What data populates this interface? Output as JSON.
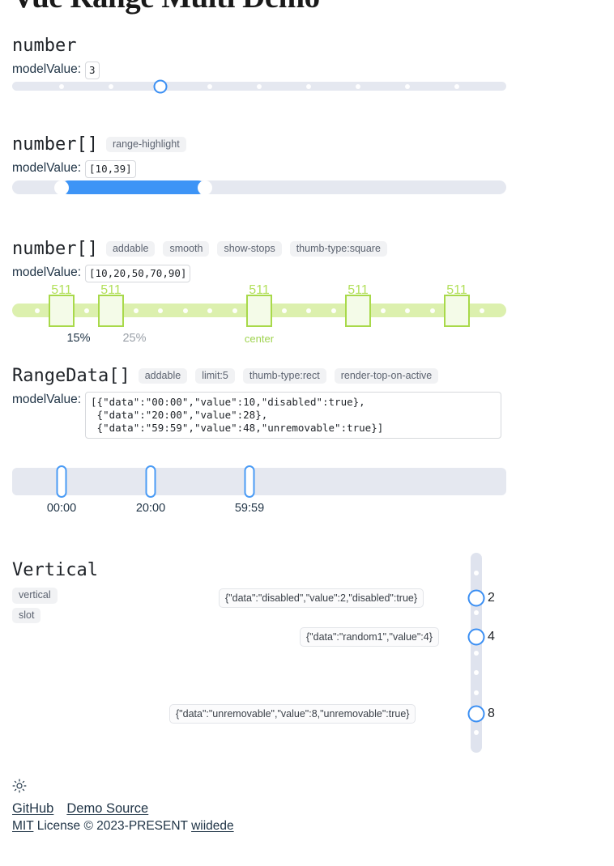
{
  "title": "Vue Range Multi Demo",
  "sections": [
    {
      "id": "number",
      "title": "number",
      "chips": [],
      "model_label": "modelValue:",
      "model_value": "3",
      "slider": {
        "type": "horizontal",
        "min": 0,
        "max": 10,
        "value": 3,
        "stops": [
          1,
          2,
          3,
          4,
          5,
          6,
          7,
          8,
          9
        ],
        "thumb_type": "circle"
      }
    },
    {
      "id": "number-array",
      "title": "number[]",
      "chips": [
        "range-highlight"
      ],
      "model_label": "modelValue:",
      "model_value": "[10,39]",
      "slider": {
        "type": "horizontal",
        "min": 0,
        "max": 100,
        "values": [
          10,
          39
        ],
        "highlight": true,
        "thumb_type": "circle"
      }
    },
    {
      "id": "number-array-stops",
      "title": "number[]",
      "chips": [
        "addable",
        "smooth",
        "show-stops",
        "thumb-type:square"
      ],
      "model_label": "modelValue:",
      "model_value": "[10,20,50,70,90]",
      "slider": {
        "type": "horizontal",
        "min": 0,
        "max": 100,
        "values": [
          10,
          20,
          50,
          70,
          90
        ],
        "thumb_type": "square",
        "thumb_top_labels": [
          "511",
          "511",
          "511",
          "511",
          "511"
        ],
        "stops_percent": [
          5,
          15,
          25,
          30,
          35,
          40,
          45,
          55,
          60,
          65,
          75,
          80,
          85,
          95
        ],
        "bottom_labels": [
          {
            "percent": 10,
            "text": "15%",
            "style": "dark"
          },
          {
            "percent": 20,
            "text": "25%",
            "style": "muted"
          },
          {
            "percent": 50,
            "text": "center",
            "style": "green"
          }
        ]
      }
    },
    {
      "id": "rangedata",
      "title": "RangeData[]",
      "chips": [
        "addable",
        "limit:5",
        "thumb-type:rect",
        "render-top-on-active"
      ],
      "model_label": "modelValue:",
      "model_value": "[{\"data\":\"00:00\",\"value\":10,\"disabled\":true},\n {\"data\":\"20:00\",\"value\":28},\n {\"data\":\"59:59\",\"value\":48,\"unremovable\":true}]",
      "slider": {
        "type": "horizontal",
        "min": 0,
        "max": 100,
        "thumb_type": "rect",
        "items": [
          {
            "data": "00:00",
            "value": 10,
            "disabled": true
          },
          {
            "data": "20:00",
            "value": 28
          },
          {
            "data": "59:59",
            "value": 48,
            "unremovable": true
          }
        ]
      }
    }
  ],
  "vertical": {
    "title": "Vertical",
    "chips": [
      "vertical",
      "slot"
    ],
    "min": 0,
    "max": 10,
    "stops_percent": [
      10,
      20,
      30,
      40,
      50,
      60,
      70,
      80,
      90
    ],
    "items": [
      {
        "value": 2,
        "value_label": "2",
        "slot": "{\"data\":\"disabled\",\"value\":2,\"disabled\":true}"
      },
      {
        "value": 4,
        "value_label": "4",
        "slot": "{\"data\":\"random1\",\"value\":4}"
      },
      {
        "value": 8,
        "value_label": "8",
        "slot": "{\"data\":\"unremovable\",\"value\":8,\"unremovable\":true}"
      }
    ]
  },
  "footer": {
    "theme_icon": "sun-icon",
    "links": [
      {
        "label": "GitHub"
      },
      {
        "label": "Demo Source"
      }
    ],
    "license_prefix": "MIT",
    "license_text": " License © 2023-PRESENT ",
    "author": "wiidede"
  },
  "colors": {
    "accent_blue": "#3b8ff3",
    "highlight_blue": "#3d94f6",
    "rail_grey": "#e5e8f0",
    "green_rail": "#dcf0ae",
    "green_border": "#a8d94a",
    "green_text": "#b3e05c",
    "text": "#213547",
    "chip_bg": "#f1f2f4"
  }
}
